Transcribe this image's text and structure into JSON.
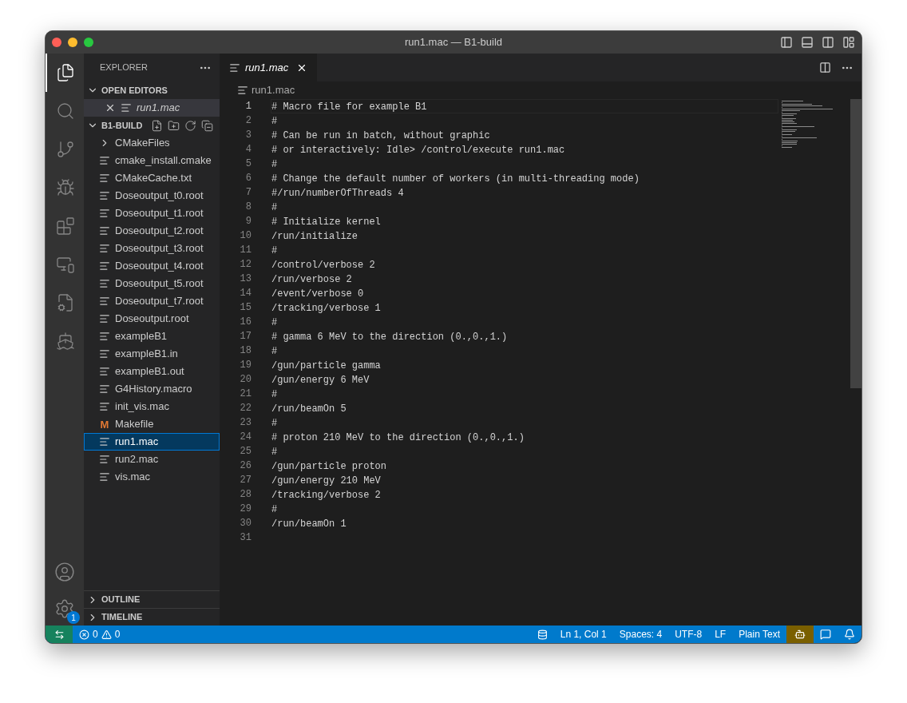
{
  "window": {
    "title": "run1.mac — B1-build"
  },
  "activity_bar": {
    "top": [
      {
        "kind": "files",
        "selected": true
      },
      {
        "kind": "search",
        "selected": false
      },
      {
        "kind": "source-control",
        "selected": false
      },
      {
        "kind": "debug",
        "selected": false
      },
      {
        "kind": "extensions",
        "selected": false
      },
      {
        "kind": "remote",
        "selected": false
      },
      {
        "kind": "cmake",
        "selected": false
      },
      {
        "kind": "docker",
        "selected": false
      }
    ],
    "settings_badge": "1"
  },
  "sidebar": {
    "title": "EXPLORER",
    "open_editors": {
      "title": "OPEN EDITORS",
      "expanded": true,
      "items": [
        {
          "label": "run1.mac",
          "selected": true
        }
      ]
    },
    "folder": {
      "title": "B1-BUILD",
      "expanded": true,
      "items": [
        {
          "label": "CMakeFiles",
          "kind": "folder",
          "expanded": false,
          "selected": false
        },
        {
          "label": "cmake_install.cmake",
          "kind": "file",
          "selected": false
        },
        {
          "label": "CMakeCache.txt",
          "kind": "file",
          "selected": false
        },
        {
          "label": "Doseoutput_t0.root",
          "kind": "file",
          "selected": false
        },
        {
          "label": "Doseoutput_t1.root",
          "kind": "file",
          "selected": false
        },
        {
          "label": "Doseoutput_t2.root",
          "kind": "file",
          "selected": false
        },
        {
          "label": "Doseoutput_t3.root",
          "kind": "file",
          "selected": false
        },
        {
          "label": "Doseoutput_t4.root",
          "kind": "file",
          "selected": false
        },
        {
          "label": "Doseoutput_t5.root",
          "kind": "file",
          "selected": false
        },
        {
          "label": "Doseoutput_t7.root",
          "kind": "file",
          "selected": false
        },
        {
          "label": "Doseoutput.root",
          "kind": "file",
          "selected": false
        },
        {
          "label": "exampleB1",
          "kind": "file",
          "selected": false
        },
        {
          "label": "exampleB1.in",
          "kind": "file",
          "selected": false
        },
        {
          "label": "exampleB1.out",
          "kind": "file",
          "selected": false
        },
        {
          "label": "G4History.macro",
          "kind": "file",
          "selected": false
        },
        {
          "label": "init_vis.mac",
          "kind": "file",
          "selected": false
        },
        {
          "label": "Makefile",
          "kind": "makefile",
          "icon_text": "M",
          "selected": false
        },
        {
          "label": "run1.mac",
          "kind": "file",
          "selected": true
        },
        {
          "label": "run2.mac",
          "kind": "file",
          "selected": false
        },
        {
          "label": "vis.mac",
          "kind": "file",
          "selected": false
        }
      ]
    },
    "bottom_sections": [
      {
        "title": "OUTLINE",
        "expanded": false
      },
      {
        "title": "TIMELINE",
        "expanded": false
      }
    ]
  },
  "tabs": [
    {
      "label": "run1.mac",
      "selected": true
    }
  ],
  "breadcrumb": "run1.mac",
  "editor": {
    "lines": [
      {
        "number": "1",
        "text": "# Macro file for example B1",
        "current": true
      },
      {
        "number": "2",
        "text": "#",
        "current": false
      },
      {
        "number": "3",
        "text": "# Can be run in batch, without graphic",
        "current": false
      },
      {
        "number": "4",
        "text": "# or interactively: Idle> /control/execute run1.mac",
        "current": false
      },
      {
        "number": "5",
        "text": "#",
        "current": false
      },
      {
        "number": "6",
        "text": "# Change the default number of workers (in multi-threading mode)",
        "current": false
      },
      {
        "number": "7",
        "text": "#/run/numberOfThreads 4",
        "current": false
      },
      {
        "number": "8",
        "text": "#",
        "current": false
      },
      {
        "number": "9",
        "text": "# Initialize kernel",
        "current": false
      },
      {
        "number": "10",
        "text": "/run/initialize",
        "current": false
      },
      {
        "number": "11",
        "text": "#",
        "current": false
      },
      {
        "number": "12",
        "text": "/control/verbose 2",
        "current": false
      },
      {
        "number": "13",
        "text": "/run/verbose 2",
        "current": false
      },
      {
        "number": "14",
        "text": "/event/verbose 0",
        "current": false
      },
      {
        "number": "15",
        "text": "/tracking/verbose 1",
        "current": false
      },
      {
        "number": "16",
        "text": "#",
        "current": false
      },
      {
        "number": "17",
        "text": "# gamma 6 MeV to the direction (0.,0.,1.)",
        "current": false
      },
      {
        "number": "18",
        "text": "#",
        "current": false
      },
      {
        "number": "19",
        "text": "/gun/particle gamma",
        "current": false
      },
      {
        "number": "20",
        "text": "/gun/energy 6 MeV",
        "current": false
      },
      {
        "number": "21",
        "text": "#",
        "current": false
      },
      {
        "number": "22",
        "text": "/run/beamOn 5",
        "current": false
      },
      {
        "number": "23",
        "text": "#",
        "current": false
      },
      {
        "number": "24",
        "text": "# proton 210 MeV to the direction (0.,0.,1.)",
        "current": false
      },
      {
        "number": "25",
        "text": "#",
        "current": false
      },
      {
        "number": "26",
        "text": "/gun/particle proton",
        "current": false
      },
      {
        "number": "27",
        "text": "/gun/energy 210 MeV",
        "current": false
      },
      {
        "number": "28",
        "text": "/tracking/verbose 2",
        "current": false
      },
      {
        "number": "29",
        "text": "#",
        "current": false
      },
      {
        "number": "30",
        "text": "/run/beamOn 1",
        "current": false
      },
      {
        "number": "31",
        "current": false
      }
    ]
  },
  "status_bar": {
    "errors": "0",
    "warnings": "0",
    "items": [
      {
        "kind": "database"
      },
      {
        "kind": "text",
        "label": "Ln 1, Col 1"
      },
      {
        "kind": "text",
        "label": "Spaces: 4"
      },
      {
        "kind": "text",
        "label": "UTF-8"
      },
      {
        "kind": "text",
        "label": "LF"
      },
      {
        "kind": "text",
        "label": "Plain Text"
      },
      {
        "kind": "copilot",
        "highlighted": true
      },
      {
        "kind": "feedback"
      },
      {
        "kind": "bell"
      }
    ]
  }
}
